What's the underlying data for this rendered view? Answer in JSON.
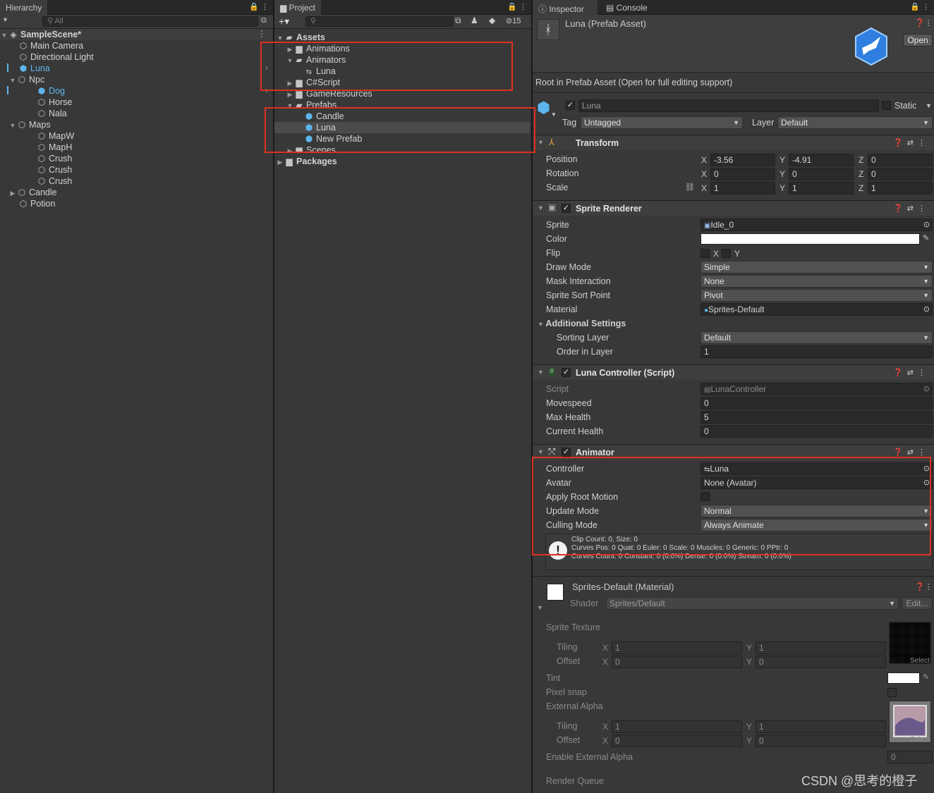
{
  "hierarchy": {
    "tab": "Hierarchy",
    "search_placeholder": "All",
    "scene": "SampleScene*",
    "items": {
      "main_camera": "Main Camera",
      "directional_light": "Directional Light",
      "luna": "Luna",
      "npc": "Npc",
      "dog": "Dog",
      "horse": "Horse",
      "nala": "Nala",
      "maps": "Maps",
      "mapw": "MapW",
      "maph": "MapH",
      "crush1": "Crush",
      "crush2": "Crush",
      "crush3": "Crush",
      "candle": "Candle",
      "potion": "Potion"
    }
  },
  "project": {
    "tab": "Project",
    "hidden_count": "15",
    "items": {
      "assets": "Assets",
      "animations": "Animations",
      "animators": "Animators",
      "animators_luna": "Luna",
      "csharp": "C#Script",
      "gameresources": "GameResources",
      "prefabs": "Prefabs",
      "candle": "Candle",
      "luna": "Luna",
      "new_prefab": "New Prefab",
      "scenes": "Scenes",
      "packages": "Packages"
    }
  },
  "inspector": {
    "tab_inspector": "Inspector",
    "tab_console": "Console",
    "asset_title": "Luna (Prefab Asset)",
    "open_button": "Open",
    "root_note": "Root in Prefab Asset (Open for full editing support)",
    "object_name": "Luna",
    "static_label": "Static",
    "tag_label": "Tag",
    "tag_value": "Untagged",
    "layer_label": "Layer",
    "layer_value": "Default",
    "transform": {
      "title": "Transform",
      "position_label": "Position",
      "px": "-3.56",
      "py": "-4.91",
      "pz": "0",
      "rotation_label": "Rotation",
      "rx": "0",
      "ry": "0",
      "rz": "0",
      "scale_label": "Scale",
      "sx": "1",
      "sy": "1",
      "sz": "1"
    },
    "sprite_renderer": {
      "title": "Sprite Renderer",
      "sprite_label": "Sprite",
      "sprite_value": "Idle_0",
      "color_label": "Color",
      "flip_label": "Flip",
      "draw_mode_label": "Draw Mode",
      "draw_mode_value": "Simple",
      "mask_label": "Mask Interaction",
      "mask_value": "None",
      "sort_point_label": "Sprite Sort Point",
      "sort_point_value": "Pivot",
      "material_label": "Material",
      "material_value": "Sprites-Default",
      "additional_label": "Additional Settings",
      "sorting_layer_label": "Sorting Layer",
      "sorting_layer_value": "Default",
      "order_label": "Order in Layer",
      "order_value": "1"
    },
    "luna_controller": {
      "title": "Luna Controller (Script)",
      "script_label": "Script",
      "script_value": "LunaController",
      "movespeed_label": "Movespeed",
      "movespeed_value": "0",
      "max_health_label": "Max Health",
      "max_health_value": "5",
      "current_health_label": "Current Health",
      "current_health_value": "0"
    },
    "animator": {
      "title": "Animator",
      "controller_label": "Controller",
      "controller_value": "Luna",
      "avatar_label": "Avatar",
      "avatar_value": "None (Avatar)",
      "root_motion_label": "Apply Root Motion",
      "update_mode_label": "Update Mode",
      "update_mode_value": "Normal",
      "culling_label": "Culling Mode",
      "culling_value": "Always Animate",
      "info_line1": "Clip Count: 0, Size: 0",
      "info_line2": "Curves Pos: 0 Quat: 0 Euler: 0 Scale: 0 Muscles: 0 Generic: 0 PPtr: 0",
      "info_line3": "Curves Count: 0 Constant: 0 (0.0%) Dense: 0 (0.0%) Stream: 0 (0.0%)"
    },
    "material": {
      "title": "Sprites-Default (Material)",
      "shader_label": "Shader",
      "shader_value": "Sprites/Default",
      "edit_button": "Edit...",
      "sprite_texture_label": "Sprite Texture",
      "tiling_label": "Tiling",
      "offset_label": "Offset",
      "t1x": "1",
      "t1y": "1",
      "o1x": "0",
      "o1y": "0",
      "select_label": "Select",
      "tint_label": "Tint",
      "pixel_snap_label": "Pixel snap",
      "external_alpha_label": "External Alpha",
      "t2x": "1",
      "t2y": "1",
      "o2x": "0",
      "o2y": "0",
      "enable_ext_label": "Enable External Alpha",
      "enable_ext_value": "0",
      "render_queue_label": "Render Queue"
    },
    "watermark": "CSDN @思考的橙子"
  },
  "colors": {
    "annotation_red": "#e0301e",
    "selection_blue": "#5cb6ec"
  }
}
